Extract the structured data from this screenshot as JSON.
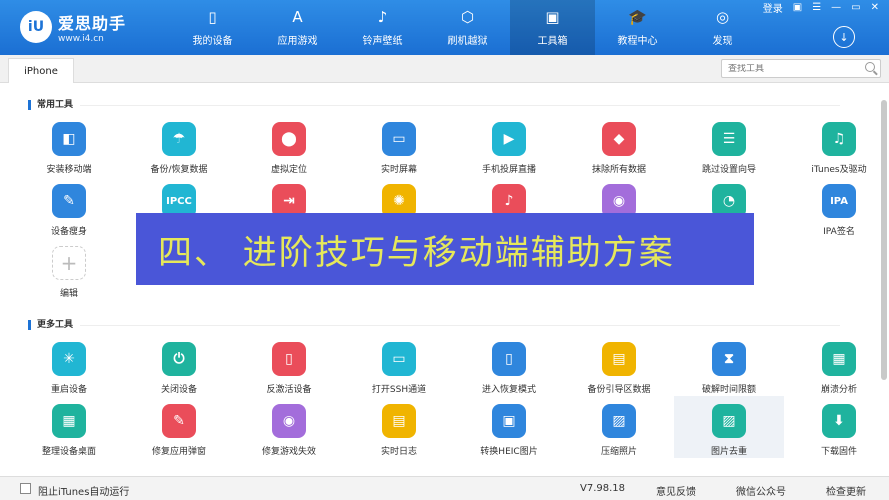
{
  "header": {
    "logo_text": "爱思助手",
    "logo_url": "www.i4.cn",
    "logo_badge": "iU",
    "nav": [
      {
        "label": "我的设备",
        "icon": "▯"
      },
      {
        "label": "应用游戏",
        "icon": "A"
      },
      {
        "label": "铃声壁纸",
        "icon": "♪"
      },
      {
        "label": "刷机越狱",
        "icon": "⬡"
      },
      {
        "label": "工具箱",
        "icon": "▣"
      },
      {
        "label": "教程中心",
        "icon": "🎓"
      },
      {
        "label": "发现",
        "icon": "◎"
      }
    ],
    "login": "登录",
    "window_controls": [
      "▣",
      "☰",
      "—",
      "▭",
      "✕"
    ],
    "download_icon": "↓"
  },
  "tabs": {
    "active": "iPhone"
  },
  "search": {
    "placeholder": "查找工具"
  },
  "sections": {
    "common_title": "常用工具",
    "more_title": "更多工具"
  },
  "common_tools": [
    {
      "label": "安装移动端",
      "icon": "◧",
      "color": "#2f86dd"
    },
    {
      "label": "备份/恢复数据",
      "icon": "☂",
      "color": "#21b6d3"
    },
    {
      "label": "虚拟定位",
      "icon": "⬤",
      "color": "#ea4d5a"
    },
    {
      "label": "实时屏幕",
      "icon": "▭",
      "color": "#2f86dd"
    },
    {
      "label": "手机投屏直播",
      "icon": "▶",
      "color": "#21b6d3"
    },
    {
      "label": "抹除所有数据",
      "icon": "◆",
      "color": "#ea4d5a"
    },
    {
      "label": "跳过设置向导",
      "icon": "☰",
      "color": "#1fb39e"
    },
    {
      "label": "iTunes及驱动",
      "icon": "♫",
      "color": "#1fb39e"
    },
    {
      "label": "设备瘦身",
      "icon": "✎",
      "color": "#2f86dd"
    },
    {
      "label": "",
      "icon": "IPCC",
      "color": "#21b6d3"
    },
    {
      "label": "",
      "icon": "⇥",
      "color": "#ea4d5a"
    },
    {
      "label": "",
      "icon": "✺",
      "color": "#f0b400"
    },
    {
      "label": "",
      "icon": "♪",
      "color": "#ea4d5a"
    },
    {
      "label": "",
      "icon": "◉",
      "color": "#a36ddb"
    },
    {
      "label": "",
      "icon": "◔",
      "color": "#1fb39e"
    },
    {
      "label": "IPA签名",
      "icon": "IPA",
      "color": "#2f86dd"
    },
    {
      "label": "编辑",
      "icon": "+",
      "color": "add"
    }
  ],
  "more_tools": [
    {
      "label": "重启设备",
      "icon": "✳",
      "color": "#21b6d3"
    },
    {
      "label": "关闭设备",
      "icon": "⏻",
      "color": "#1fb39e"
    },
    {
      "label": "反激活设备",
      "icon": "▯",
      "color": "#ea4d5a"
    },
    {
      "label": "打开SSH通道",
      "icon": "▭",
      "color": "#21b6d3"
    },
    {
      "label": "进入恢复模式",
      "icon": "▯",
      "color": "#2f86dd"
    },
    {
      "label": "备份引导区数据",
      "icon": "▤",
      "color": "#f0b400"
    },
    {
      "label": "破解时间限额",
      "icon": "⧗",
      "color": "#2f86dd"
    },
    {
      "label": "崩溃分析",
      "icon": "▦",
      "color": "#1fb39e"
    },
    {
      "label": "整理设备桌面",
      "icon": "▦",
      "color": "#1fb39e"
    },
    {
      "label": "修复应用弹窗",
      "icon": "✎",
      "color": "#ea4d5a"
    },
    {
      "label": "修复游戏失效",
      "icon": "◉",
      "color": "#a36ddb"
    },
    {
      "label": "实时日志",
      "icon": "▤",
      "color": "#f0b400"
    },
    {
      "label": "转换HEIC图片",
      "icon": "▣",
      "color": "#2f86dd"
    },
    {
      "label": "压缩照片",
      "icon": "▨",
      "color": "#2f86dd"
    },
    {
      "label": "图片去重",
      "icon": "▨",
      "color": "#1fb39e"
    },
    {
      "label": "下载固件",
      "icon": "⬇",
      "color": "#1fb39e"
    }
  ],
  "overlay": {
    "text": "四、 进阶技巧与移动端辅助方案"
  },
  "statusbar": {
    "itunes_block": "阻止iTunes自动运行",
    "version": "V7.98.18",
    "feedback": "意见反馈",
    "wechat": "微信公众号",
    "update": "检查更新"
  }
}
